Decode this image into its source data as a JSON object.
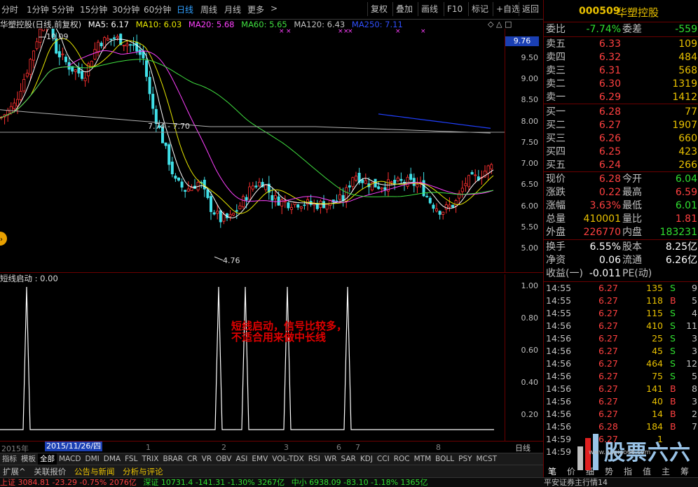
{
  "toolbar": {
    "periods": [
      "分时",
      "1分钟",
      "5分钟",
      "15分钟",
      "30分钟",
      "60分钟",
      "日线",
      "周线",
      "月线",
      "更多"
    ],
    "active_period": "日线",
    "more_arrow": ">",
    "right_buttons": [
      "复权",
      "叠加",
      "画线",
      "F10",
      "标记",
      "+自选",
      "返回"
    ]
  },
  "chart": {
    "title": "华塑控股(日线,前复权)",
    "ma": [
      {
        "label": "MA5: 6.17",
        "color": "#ffffff"
      },
      {
        "label": "MA10: 6.03",
        "color": "#e8e800"
      },
      {
        "label": "MA20: 5.68",
        "color": "#ff40ff"
      },
      {
        "label": "MA60: 5.65",
        "color": "#40e040"
      },
      {
        "label": "MA120: 6.43",
        "color": "#c0c0c0"
      },
      {
        "label": "MA250: 7.11",
        "color": "#3050ff"
      }
    ],
    "high_label": "10.09",
    "low_label": "4.76",
    "level_label": "7.74 - 7.70",
    "current_price": "9.76",
    "price_ticks": [
      "9.50",
      "9.00",
      "8.50",
      "8.00",
      "7.50",
      "7.00",
      "6.50",
      "6.00",
      "5.50",
      "5.00"
    ],
    "corner_icons": [
      "◇",
      "△",
      "□"
    ]
  },
  "indicator": {
    "title": "短线启动 : 0.00",
    "ticks": [
      "1.00",
      "0.80",
      "0.60",
      "0.40",
      "0.20"
    ],
    "annotation": "短线启动，信号比较多，不适合用来做中长线"
  },
  "date_axis": {
    "year": "2015年",
    "selected_date": "2015/11/26/四",
    "months": [
      "1",
      "2",
      "3",
      "6",
      "7",
      "8"
    ],
    "period_label": "日线"
  },
  "indicator_tabs": [
    "指标",
    "模板",
    "全部",
    "MACD",
    "DMI",
    "DMA",
    "FSL",
    "TRIX",
    "BRAR",
    "CR",
    "VR",
    "OBV",
    "ASI",
    "EMV",
    "VOL-TDX",
    "RSI",
    "WR",
    "SAR",
    "KDJ",
    "CCI",
    "ROC",
    "MTM",
    "BOLL",
    "PSY",
    "MCST"
  ],
  "active_indicator_tab": "全部",
  "bottom_tabs": [
    "扩展^",
    "关联报价",
    "公告与新闻",
    "分析与评论"
  ],
  "status": {
    "sh": "上证 3084.81 -23.29 -0.75% 2076亿",
    "sz": "深证 10731.4 -141.31 -1.30% 3267亿",
    "mid": "中小 6938.09 -83.10 -1.18% 1365亿",
    "broker": "平安证券主行情14"
  },
  "quote": {
    "code": "000509",
    "name": "华塑控股",
    "weibi_label": "委比",
    "weibi": "-7.74%",
    "weicha_label": "委差",
    "weicha": "-559",
    "asks": [
      {
        "label": "卖五",
        "price": "6.33",
        "vol": "109"
      },
      {
        "label": "卖四",
        "price": "6.32",
        "vol": "484"
      },
      {
        "label": "卖三",
        "price": "6.31",
        "vol": "568"
      },
      {
        "label": "卖二",
        "price": "6.30",
        "vol": "1319"
      },
      {
        "label": "卖一",
        "price": "6.29",
        "vol": "1412"
      }
    ],
    "bids": [
      {
        "label": "买一",
        "price": "6.28",
        "vol": "77"
      },
      {
        "label": "买二",
        "price": "6.27",
        "vol": "1907"
      },
      {
        "label": "买三",
        "price": "6.26",
        "vol": "660"
      },
      {
        "label": "买四",
        "price": "6.25",
        "vol": "423"
      },
      {
        "label": "买五",
        "price": "6.24",
        "vol": "266"
      }
    ],
    "stats": [
      {
        "k1": "现价",
        "v1": "6.28",
        "c1": "red",
        "k2": "今开",
        "v2": "6.04",
        "c2": "green"
      },
      {
        "k1": "涨跌",
        "v1": "0.22",
        "c1": "red",
        "k2": "最高",
        "v2": "6.59",
        "c2": "red"
      },
      {
        "k1": "涨幅",
        "v1": "3.63%",
        "c1": "red",
        "k2": "最低",
        "v2": "6.01",
        "c2": "green"
      },
      {
        "k1": "总量",
        "v1": "410001",
        "c1": "yellow",
        "k2": "量比",
        "v2": "1.81",
        "c2": "red"
      },
      {
        "k1": "外盘",
        "v1": "226770",
        "c1": "red",
        "k2": "内盘",
        "v2": "183231",
        "c2": "green"
      }
    ],
    "fin": [
      {
        "k1": "换手",
        "v1": "6.55%",
        "k2": "股本",
        "v2": "8.25亿"
      },
      {
        "k1": "净资",
        "v1": "0.06",
        "k2": "流通",
        "v2": "6.26亿"
      },
      {
        "k1": "收益(一)",
        "v1": "-0.011",
        "k2": "PE(动)",
        "v2": ""
      }
    ],
    "ticks": [
      {
        "t": "14:55",
        "p": "6.27",
        "v": "135",
        "s": "S",
        "n": "9"
      },
      {
        "t": "14:55",
        "p": "6.27",
        "v": "118",
        "s": "B",
        "n": "5"
      },
      {
        "t": "14:55",
        "p": "6.27",
        "v": "115",
        "s": "S",
        "n": "4"
      },
      {
        "t": "14:56",
        "p": "6.27",
        "v": "410",
        "s": "S",
        "n": "11"
      },
      {
        "t": "14:56",
        "p": "6.27",
        "v": "25",
        "s": "S",
        "n": "3"
      },
      {
        "t": "14:56",
        "p": "6.27",
        "v": "45",
        "s": "S",
        "n": "3"
      },
      {
        "t": "14:56",
        "p": "6.27",
        "v": "464",
        "s": "S",
        "n": "12"
      },
      {
        "t": "14:56",
        "p": "6.27",
        "v": "75",
        "s": "S",
        "n": "5"
      },
      {
        "t": "14:56",
        "p": "6.27",
        "v": "141",
        "s": "B",
        "n": "8"
      },
      {
        "t": "14:56",
        "p": "6.27",
        "v": "40",
        "s": "B",
        "n": "3"
      },
      {
        "t": "14:56",
        "p": "6.27",
        "v": "14",
        "s": "B",
        "n": "2"
      },
      {
        "t": "14:56",
        "p": "6.28",
        "v": "184",
        "s": "B",
        "n": "7"
      },
      {
        "t": "14:59",
        "p": "6.27",
        "v": "1",
        "s": "",
        "n": ""
      },
      {
        "t": "14:59",
        "p": "",
        "v": "",
        "s": "",
        "n": ""
      }
    ],
    "footer": [
      "笔",
      "价",
      "细",
      "势",
      "指",
      "值",
      "主",
      "筹"
    ],
    "watermark": "股票六六",
    "watermark_sub": "www.gupiao66.com"
  }
}
